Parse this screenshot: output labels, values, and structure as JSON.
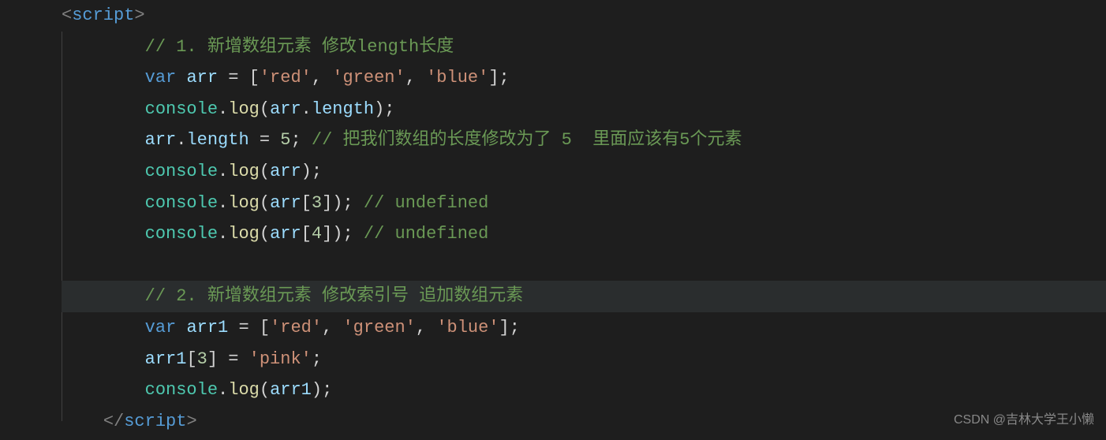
{
  "code": {
    "tag_open_left": "<",
    "tag_open_right": ">",
    "tag_close_left": "</",
    "script_tag": "script",
    "indent1": "    ",
    "indent2": "        ",
    "comment1": "// 1. 新增数组元素 修改length长度",
    "kw_var": "var",
    "sp": " ",
    "arr": "arr",
    "eq": " = ",
    "lbracket": "[",
    "rbracket": "]",
    "str_red": "'red'",
    "str_green": "'green'",
    "str_blue": "'blue'",
    "str_pink": "'pink'",
    "comma_sp": ", ",
    "semi": ";",
    "console": "console",
    "dot": ".",
    "log": "log",
    "lparen": "(",
    "rparen": ")",
    "length": "length",
    "num5": "5",
    "num3": "3",
    "num4": "4",
    "comment_len5": " // 把我们数组的长度修改为了 5  里面应该有5个元素",
    "comment_undef": " // undefined",
    "blank": "",
    "comment2": "// 2. 新增数组元素 修改索引号 追加数组元素",
    "arr1": "arr1",
    "eq_sp": " = "
  },
  "watermark": "CSDN @吉林大学王小懒"
}
